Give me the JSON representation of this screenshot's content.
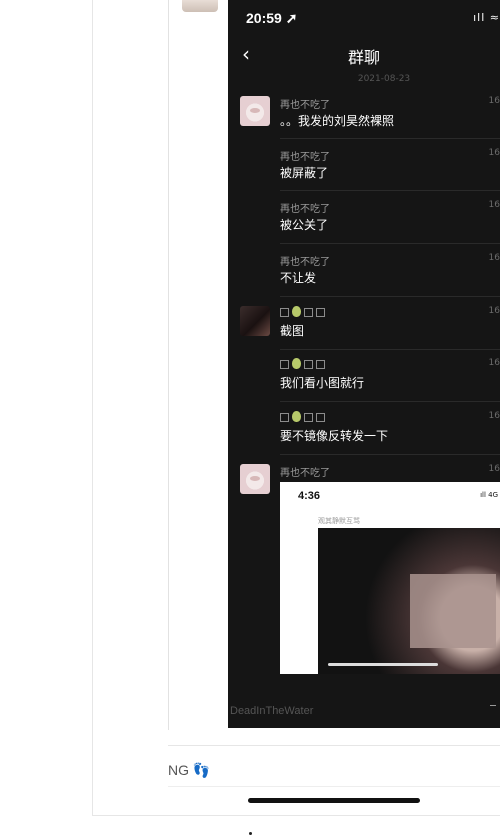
{
  "phone": {
    "status": {
      "time": "20:59 ➚",
      "icons": "ıll ≈"
    },
    "nav": {
      "back_icon": "back-arrow-icon",
      "title": "群聊"
    },
    "date": "2021-08-23",
    "messages": [
      {
        "sender": "再也不吃了",
        "text": "。。我发的刘昊然裸照",
        "time": "16"
      },
      {
        "sender": "再也不吃了",
        "text": "被屏蔽了",
        "time": "16"
      },
      {
        "sender": "再也不吃了",
        "text": "被公关了",
        "time": "16"
      },
      {
        "sender": "再也不吃了",
        "text": "不让发",
        "time": "16"
      },
      {
        "sender": "",
        "text": "截图",
        "time": "16"
      },
      {
        "sender": "",
        "text": "我们看小图就行",
        "time": "16"
      },
      {
        "sender": "",
        "text": "要不镜像反转发一下",
        "time": "16"
      },
      {
        "sender": "再也不吃了",
        "text": "",
        "time": "16"
      }
    ],
    "embedded": {
      "time": "4:36",
      "icons": "ıll 4G",
      "caption": "观其静默互骂"
    }
  },
  "watermark": "DeadInTheWater",
  "reply": {
    "text": "NG 👣"
  },
  "colors": {
    "chat_bg": "#151515",
    "page_bg": "#ffffff",
    "name_gray": "#9a9a9a"
  }
}
